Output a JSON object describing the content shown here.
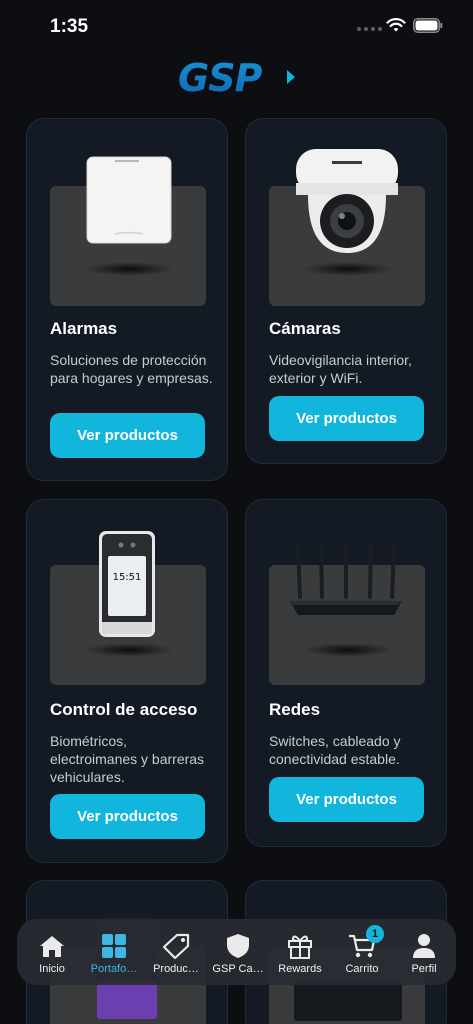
{
  "status_bar": {
    "time": "1:35"
  },
  "brand": {
    "logo_text": "GSP",
    "accent_color": "#12b5dc"
  },
  "categories": [
    {
      "title": "Alarmas",
      "description": "Soluciones de protección para hogares y empresas.",
      "button_label": "Ver productos",
      "icon": "alarm-panel-image"
    },
    {
      "title": "Cámaras",
      "description": "Videovigilancia interior, exterior y WiFi.",
      "button_label": "Ver productos",
      "icon": "dome-camera-image"
    },
    {
      "title": "Control de acceso",
      "description": "Biométricos, electroimanes y barreras vehiculares.",
      "button_label": "Ver productos",
      "icon": "access-terminal-image"
    },
    {
      "title": "Redes",
      "description": "Switches, cableado y conectividad estable.",
      "button_label": "Ver productos",
      "icon": "router-image"
    }
  ],
  "access_terminal_time": "15:51",
  "tab_bar": {
    "items": [
      {
        "label": "Inicio",
        "icon": "home-icon"
      },
      {
        "label": "Portafo…",
        "icon": "grid-icon",
        "active": true
      },
      {
        "label": "Produc…",
        "icon": "tag-icon"
      },
      {
        "label": "GSP Ca…",
        "icon": "shield-icon"
      },
      {
        "label": "Rewards",
        "icon": "gift-icon"
      },
      {
        "label": "Carrito",
        "icon": "cart-icon",
        "badge": "1"
      },
      {
        "label": "Perfil",
        "icon": "person-icon"
      }
    ]
  }
}
